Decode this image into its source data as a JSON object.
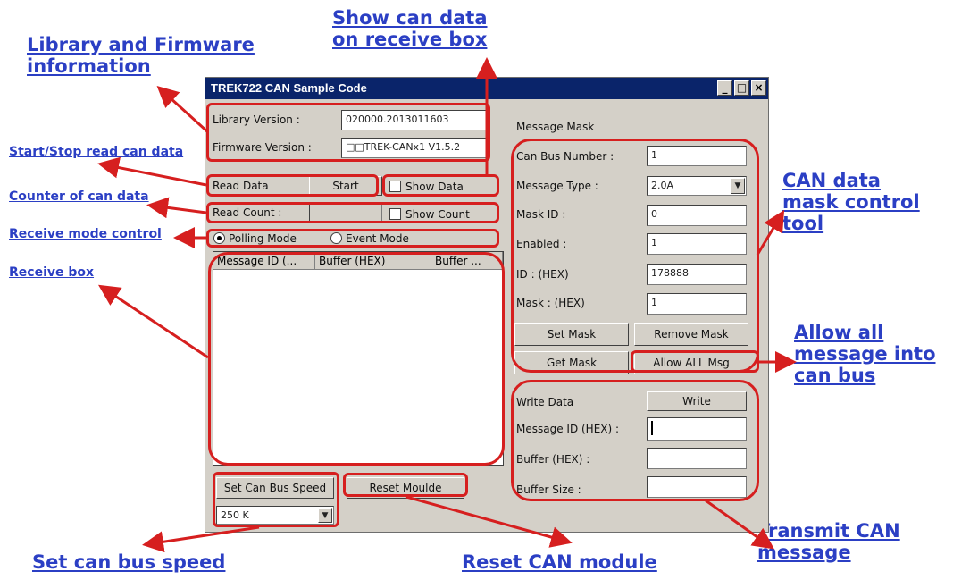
{
  "annotations": {
    "library_firmware": [
      "Library and Firmware",
      "information"
    ],
    "show_can_data": [
      "Show can data",
      "on receive box"
    ],
    "start_stop": "Start/Stop read can data",
    "counter": "Counter of can data",
    "receive_mode": "Receive mode control",
    "receive_box": "Receive box",
    "can_mask": [
      "CAN data",
      "mask control",
      "tool"
    ],
    "allow_all": [
      "Allow all",
      "message into",
      "can bus"
    ],
    "transmit": [
      "Transmit CAN",
      "message"
    ],
    "set_speed": "Set can bus speed",
    "reset_module": "Reset CAN module"
  },
  "window": {
    "title": "TREK722 CAN Sample Code",
    "library_version_label": "Library Version :",
    "library_version_value": "020000.2013011603",
    "firmware_version_label": "Firmware Version :",
    "firmware_version_value": "□□TREK-CANx1 V1.5.2",
    "read_data_label": "Read Data",
    "start_button": "Start",
    "show_data_label": "Show Data",
    "read_count_label": "Read Count :",
    "show_count_label": "Show Count",
    "polling_mode": "Polling Mode",
    "event_mode": "Event Mode",
    "columns": [
      "Message ID (...",
      "Buffer (HEX)",
      "Buffer ..."
    ],
    "set_speed_button": "Set Can Bus Speed",
    "reset_button": "Reset Moulde",
    "speed_value": "250 K",
    "mask": {
      "title": "Message Mask",
      "can_bus_number_label": "Can Bus Number :",
      "can_bus_number_value": "1",
      "message_type_label": "Message Type :",
      "message_type_value": "2.0A",
      "mask_id_label": "Mask ID :",
      "mask_id_value": "0",
      "enabled_label": "Enabled :",
      "enabled_value": "1",
      "id_hex_label": "ID : (HEX)",
      "id_hex_value": "178888",
      "mask_hex_label": "Mask : (HEX)",
      "mask_hex_value": "1",
      "set_mask": "Set Mask",
      "remove_mask": "Remove Mask",
      "get_mask": "Get Mask",
      "allow_all": "Allow ALL Msg"
    },
    "write": {
      "write_data_label": "Write Data",
      "write_button": "Write",
      "message_id_label": "Message ID (HEX) :",
      "buffer_label": "Buffer (HEX) :",
      "buffer_size_label": "Buffer Size :"
    }
  },
  "colors": {
    "annotation": "#2b3fc4",
    "highlight": "#d61f1f",
    "titlebar": "#0a246a"
  }
}
